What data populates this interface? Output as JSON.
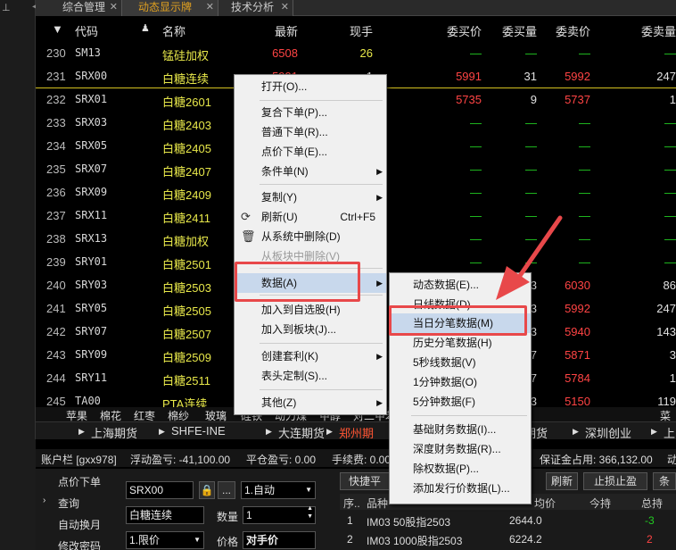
{
  "icons": {
    "pin": "pin-icon",
    "refresh": "refresh-icon",
    "delete": "trash-icon",
    "lock": "lock-icon"
  },
  "tabs": [
    {
      "label": "综合管理",
      "active": false
    },
    {
      "label": "动态显示牌",
      "active": true
    },
    {
      "label": "技术分析",
      "active": false
    }
  ],
  "table": {
    "headers": {
      "code": "代码",
      "name": "名称",
      "last": "最新",
      "now": "现手",
      "bid": "委买价",
      "bidv": "委买量",
      "ask": "委卖价",
      "askv": "委卖量"
    },
    "rows": [
      {
        "seq": "230",
        "code": "SM13",
        "name": "锰硅加权",
        "last": "6508",
        "now": "26",
        "bid": "—",
        "bidv": "—",
        "ask": "—",
        "askv": "—"
      },
      {
        "seq": "231",
        "code": "SRX00",
        "name": "白糖连续",
        "last": "5991",
        "now": "1",
        "bid": "5991",
        "bidv": "31",
        "ask": "5992",
        "askv": "247"
      },
      {
        "seq": "232",
        "code": "SRX01",
        "name": "白糖2601",
        "last": "",
        "now": "",
        "bid": "5735",
        "bidv": "9",
        "ask": "5737",
        "askv": "1"
      },
      {
        "seq": "233",
        "code": "SRX03",
        "name": "白糖2403",
        "last": "",
        "now": "",
        "bid": "—",
        "bidv": "—",
        "ask": "—",
        "askv": "—"
      },
      {
        "seq": "234",
        "code": "SRX05",
        "name": "白糖2405",
        "last": "",
        "now": "",
        "bid": "—",
        "bidv": "—",
        "ask": "—",
        "askv": "—"
      },
      {
        "seq": "235",
        "code": "SRX07",
        "name": "白糖2407",
        "last": "",
        "now": "",
        "bid": "—",
        "bidv": "—",
        "ask": "—",
        "askv": "—"
      },
      {
        "seq": "236",
        "code": "SRX09",
        "name": "白糖2409",
        "last": "",
        "now": "",
        "bid": "—",
        "bidv": "—",
        "ask": "—",
        "askv": "—"
      },
      {
        "seq": "237",
        "code": "SRX11",
        "name": "白糖2411",
        "last": "",
        "now": "",
        "bid": "—",
        "bidv": "—",
        "ask": "—",
        "askv": "—"
      },
      {
        "seq": "238",
        "code": "SRX13",
        "name": "白糖加权",
        "last": "",
        "now": "",
        "bid": "—",
        "bidv": "—",
        "ask": "—",
        "askv": "—"
      },
      {
        "seq": "239",
        "code": "SRY01",
        "name": "白糖2501",
        "last": "",
        "now": "",
        "bid": "—",
        "bidv": "—",
        "ask": "—",
        "askv": "—"
      },
      {
        "seq": "240",
        "code": "SRY03",
        "name": "白糖2503",
        "last": "",
        "now": "",
        "bid": "",
        "bidv": "3",
        "ask": "6030",
        "askv": "86"
      },
      {
        "seq": "241",
        "code": "SRY05",
        "name": "白糖2505",
        "last": "",
        "now": "",
        "bid": "",
        "bidv": "3",
        "ask": "5992",
        "askv": "247"
      },
      {
        "seq": "242",
        "code": "SRY07",
        "name": "白糖2507",
        "last": "",
        "now": "",
        "bid": "",
        "bidv": "3",
        "ask": "5940",
        "askv": "143"
      },
      {
        "seq": "243",
        "code": "SRY09",
        "name": "白糖2509",
        "last": "",
        "now": "",
        "bid": "",
        "bidv": "7",
        "ask": "5871",
        "askv": "3"
      },
      {
        "seq": "244",
        "code": "SRY11",
        "name": "白糖2511",
        "last": "",
        "now": "",
        "bid": "",
        "bidv": "7",
        "ask": "5784",
        "askv": "1"
      },
      {
        "seq": "245",
        "code": "TA00",
        "name": "PTA连续",
        "last": "",
        "now": "",
        "bid": "",
        "bidv": "3",
        "ask": "5150",
        "askv": "119"
      }
    ]
  },
  "nav": {
    "categories": [
      "苹果",
      "棉花",
      "红枣",
      "棉纱",
      "玻璃",
      "硅铁",
      "动力煤",
      "甲醇",
      "对二甲苯",
      "早籼稻",
      "菜粕",
      "菜"
    ],
    "exchanges": [
      "上海期货",
      "SHFE-INE",
      "大连期货",
      "郑州期",
      "期货",
      "深圳创业",
      "上"
    ]
  },
  "account": {
    "account_label": "账户栏 [gxx978]",
    "float_pnl": "浮动盈亏: -41,100.00",
    "close_pnl": "平仓盈亏: 0.00",
    "fee": "手续费: 0.00",
    "margin": "保证金占用: 366,132.00",
    "trailing": "动"
  },
  "order": {
    "side_items": [
      "点价下单",
      "查询",
      "自动换月",
      "修改密码"
    ],
    "code_value": "SRX00",
    "dots": "...",
    "mode_value": "1.自动",
    "name_value": "白糖连续",
    "qty_label": "数量",
    "qty_value": "1",
    "price_type_value": "1.限价",
    "price_label": "价格",
    "price_value": "对手价",
    "quick_close": "快捷平",
    "refresh": "刷新",
    "stop": "止损止盈",
    "extra": "条",
    "pos_headers": {
      "seq": "序..",
      "name": "品种",
      "avg": "均价",
      "today": "今持",
      "total": "总持"
    },
    "positions": [
      {
        "seq": "1",
        "name": "IM03 50股指2503",
        "avg": "2644.0",
        "total": "-3"
      },
      {
        "seq": "2",
        "name": "IM03 1000股指2503",
        "avg": "6224.2",
        "total": "2"
      }
    ]
  },
  "menu": {
    "items": [
      {
        "label": "打开(O)...",
        "key": ""
      },
      {
        "label": "复合下单(P)...",
        "key": ""
      },
      {
        "label": "普通下单(R)...",
        "key": ""
      },
      {
        "label": "点价下单(E)...",
        "key": ""
      },
      {
        "label": "条件单(N)",
        "key": ""
      },
      {
        "label": "复制(Y)",
        "key": ""
      },
      {
        "label": "刷新(U)",
        "key": "Ctrl+F5"
      },
      {
        "label": "从系统中删除(D)",
        "key": ""
      },
      {
        "label": "从板块中删除(V)",
        "key": ""
      },
      {
        "label": "数据(A)",
        "key": ""
      },
      {
        "label": "加入到自选股(H)",
        "key": ""
      },
      {
        "label": "加入到板块(J)...",
        "key": ""
      },
      {
        "label": "创建套利(K)",
        "key": ""
      },
      {
        "label": "表头定制(S)...",
        "key": ""
      },
      {
        "label": "其他(Z)",
        "key": ""
      }
    ]
  },
  "submenu": {
    "items": [
      "动态数据(E)...",
      "日线数据(D)...",
      "当日分笔数据(M)",
      "历史分笔数据(H)",
      "5秒线数据(V)",
      "1分钟数据(O)",
      "5分钟数据(F)",
      "基础财务数据(I)...",
      "深度财务数据(R)...",
      "除权数据(P)...",
      "添加发行价数据(L)..."
    ]
  },
  "colors": {
    "annotation": "#e8484a",
    "accent_tab": "#e0a020",
    "selection_line": "#d4c020"
  }
}
